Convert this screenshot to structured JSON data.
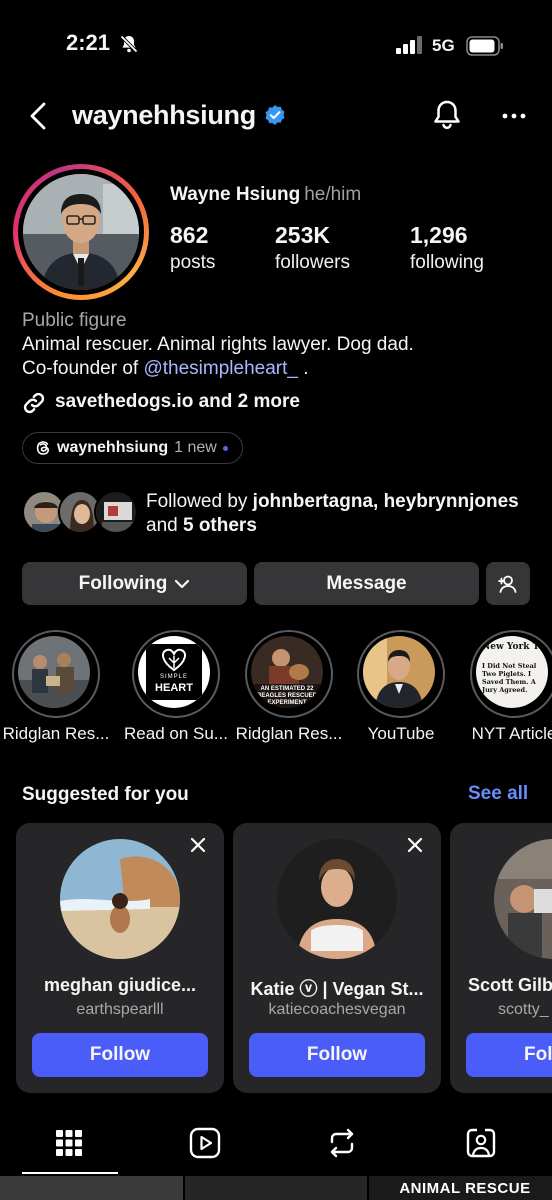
{
  "status_bar": {
    "time": "2:21",
    "network": "5G"
  },
  "header": {
    "username": "waynehhsiung"
  },
  "profile": {
    "name": "Wayne Hsiung",
    "pronouns": "he/him",
    "stats": [
      {
        "value": "862",
        "label": "posts"
      },
      {
        "value": "253K",
        "label": "followers"
      },
      {
        "value": "1,296",
        "label": "following"
      }
    ],
    "category": "Public figure",
    "bio_line1": "Animal rescuer. Animal rights lawyer. Dog dad.",
    "bio_line2_prefix": "Co-founder of ",
    "bio_mention": "@thesimpleheart_",
    "bio_line2_suffix": " .",
    "link_text": "savethedogs.io and 2 more",
    "threads_handle": "waynehhsiung",
    "threads_badge": "1 new",
    "followed_by_prefix": "Followed by ",
    "followed_by_names": "johnbertagna, heybrynnjones",
    "followed_by_mid": " and ",
    "followed_by_others": "5 others"
  },
  "actions": {
    "following": "Following",
    "message": "Message"
  },
  "highlights": [
    {
      "label": "Ridglan Res..."
    },
    {
      "label": "Read on Su..."
    },
    {
      "label": "Ridglan Res..."
    },
    {
      "label": "YouTube"
    },
    {
      "label": "NYT Article"
    }
  ],
  "highlight_texts": {
    "simple_heart_top": "SIMPLE",
    "simple_heart_bottom": "HEART",
    "beagles": "AN ESTIMATED 22 BEAGLES RESCUED EXPERIMENT",
    "nyt_masthead": "New York Ti",
    "nyt_headline": "I Did Not Steal Two Piglets. I Saved Them. A Jury Agreed."
  },
  "suggested": {
    "title": "Suggested for you",
    "see_all": "See all",
    "cards": [
      {
        "name": "meghan giudice...",
        "handle": "earthspearlll",
        "button": "Follow"
      },
      {
        "name": "Katie ⓥ | Vegan St...",
        "handle": "katiecoachesvegan",
        "button": "Follow"
      },
      {
        "name": "Scott Gilb",
        "handle": "scotty_",
        "button": "Follo"
      }
    ]
  },
  "grid_peek_text": "ANIMAL RESCUE"
}
